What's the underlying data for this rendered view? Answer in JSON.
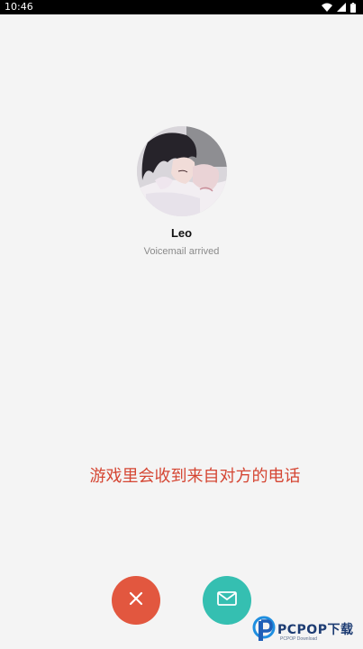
{
  "status_bar": {
    "time": "10:46",
    "icons": [
      "wifi-icon",
      "signal-icon",
      "battery-icon"
    ]
  },
  "caller": {
    "name": "Leo",
    "status": "Voicemail arrived",
    "avatar_icon": "anime-avatar-photo"
  },
  "caption": "游戏里会收到来自对方的电话",
  "actions": {
    "decline_icon": "close-icon",
    "message_icon": "mail-icon",
    "decline_color": "#e2573f",
    "message_color": "#35bfb1"
  },
  "watermark": {
    "brand": "PCPOP下载",
    "sub": "PCPOP Download"
  },
  "colors": {
    "background": "#f4f4f4",
    "caption": "#d54633",
    "status_bar": "#000000"
  }
}
